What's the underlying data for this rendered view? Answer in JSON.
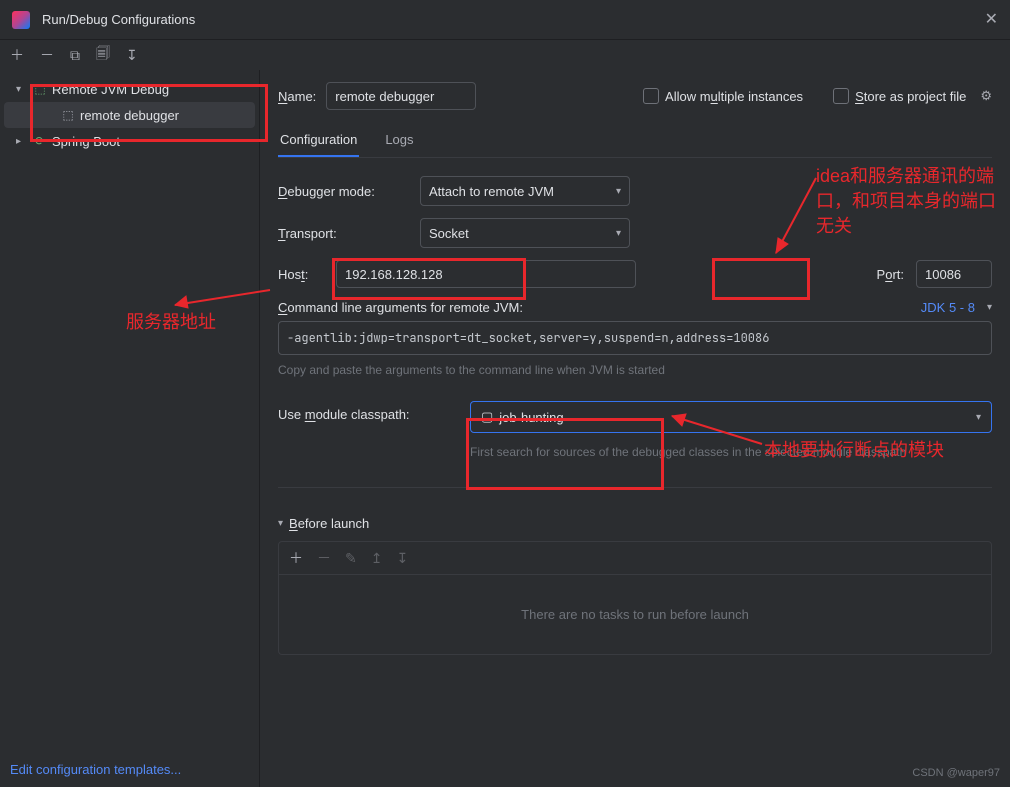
{
  "window": {
    "title": "Run/Debug Configurations"
  },
  "tree": {
    "nodes": [
      {
        "label": "Remote JVM Debug",
        "children": [
          {
            "label": "remote debugger"
          }
        ]
      },
      {
        "label": "Spring Boot"
      }
    ]
  },
  "editTemplates": "Edit configuration templates...",
  "header": {
    "nameLabel": "Name:",
    "nameValue": "remote debugger",
    "allowMultiple": "Allow multiple instances",
    "storeAsProject": "Store as project file"
  },
  "tabs": {
    "config": "Configuration",
    "logs": "Logs"
  },
  "form": {
    "debuggerModeLabel": "Debugger mode:",
    "debuggerModeValue": "Attach to remote JVM",
    "transportLabel": "Transport:",
    "transportValue": "Socket",
    "hostLabel": "Host:",
    "hostValue": "192.168.128.128",
    "portLabel": "Port:",
    "portValue": "10086",
    "cmdLabel": "Command line arguments for remote JVM:",
    "jdkVersion": "JDK 5 - 8",
    "cmdValue": "-agentlib:jdwp=transport=dt_socket,server=y,suspend=n,address=10086",
    "cmdHint": "Copy and paste the arguments to the command line when JVM is started",
    "moduleLabel": "Use module classpath:",
    "moduleValue": "job-hunting",
    "moduleHint": "First search for sources of the debugged classes in the selected module classpath"
  },
  "before": {
    "title": "Before launch",
    "empty": "There are no tasks to run before launch"
  },
  "annotations": {
    "serverAddr": "服务器地址",
    "portNote": "idea和服务器通讯的端口，和项目本身的端口无关",
    "moduleNote": "本地要执行断点的模块"
  },
  "watermark": "CSDN @waper97"
}
